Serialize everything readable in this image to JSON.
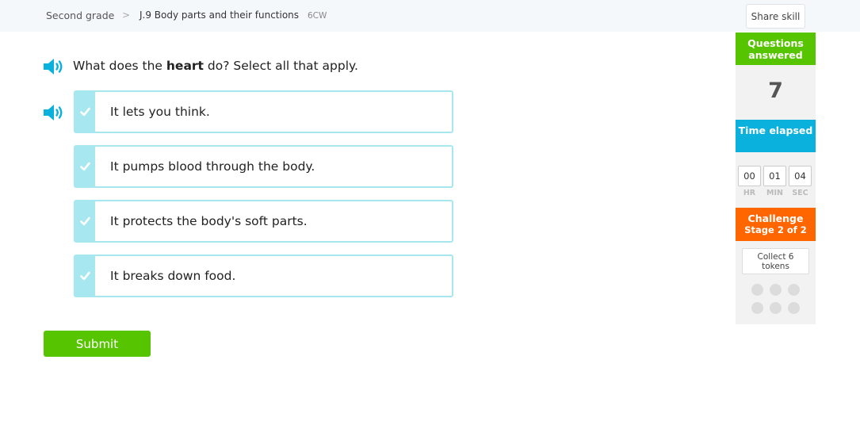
{
  "breadcrumb": {
    "grade": "Second grade",
    "separator": ">",
    "skill": "J.9 Body parts and their functions",
    "code": "6CW"
  },
  "share_label": "Share skill",
  "question": {
    "prefix": "What does the ",
    "bold": "heart",
    "suffix": " do? Select all that apply."
  },
  "options": [
    {
      "label": "It lets you think."
    },
    {
      "label": "It pumps blood through the body."
    },
    {
      "label": "It protects the body's soft parts."
    },
    {
      "label": "It breaks down food."
    }
  ],
  "submit_label": "Submit",
  "sidebar": {
    "questions_answered_label": "Questions answered",
    "questions_answered_count": "7",
    "time_elapsed_label": "Time elapsed",
    "time": {
      "hr": "00",
      "min": "01",
      "sec": "04"
    },
    "time_units": {
      "hr": "HR",
      "min": "MIN",
      "sec": "SEC"
    },
    "challenge_label": "Challenge",
    "challenge_stage": "Stage 2 of 2",
    "collect_text": "Collect 6 tokens",
    "tokens_collected": 0,
    "tokens_total": 6
  },
  "colors": {
    "accent_green": "#56c500",
    "accent_blue": "#0ab1dd",
    "accent_orange": "#ff6600",
    "option_border": "#a6e7f0",
    "speaker": "#0ab1dd"
  },
  "icons": {
    "speaker": "speaker-icon",
    "check": "check-icon",
    "chevron": "chevron-right-icon"
  }
}
